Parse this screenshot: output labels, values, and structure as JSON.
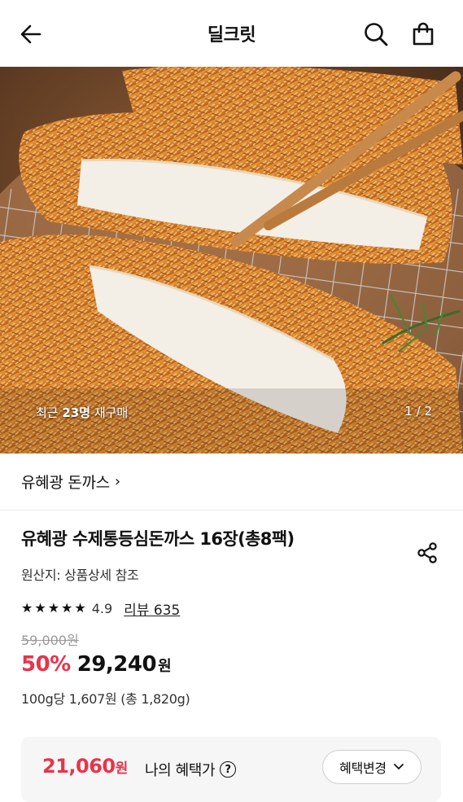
{
  "header": {
    "title": "딜크릿",
    "back_icon": "arrow-left-icon",
    "search_icon": "search-icon",
    "cart_icon": "shopping-bag-icon"
  },
  "hero": {
    "repurchase_prefix": "최근 ",
    "repurchase_count": "23명",
    "repurchase_suffix": " 재구매",
    "pager": "1 / 2"
  },
  "brand": {
    "label": "유혜광 돈까스",
    "chevron": "›"
  },
  "product": {
    "name": "유혜광 수제통등심돈까스 16장(총8팩)",
    "origin": "원산지: 상품상세 참조",
    "rating": "4.9",
    "stars": 5,
    "reviews": "리뷰 635",
    "original_price": "59,000원",
    "discount": "50%",
    "price": "29,240",
    "price_unit": "원",
    "unit_price": "100g당 1,607원 (총 1,820g)"
  },
  "benefit": {
    "price": "21,060",
    "price_unit": "원",
    "label": "나의 혜택가",
    "help": "?",
    "change_button": "혜택변경"
  },
  "colors": {
    "accent_red": "#e8344a",
    "text": "#111111",
    "muted": "#9a9a9a"
  }
}
